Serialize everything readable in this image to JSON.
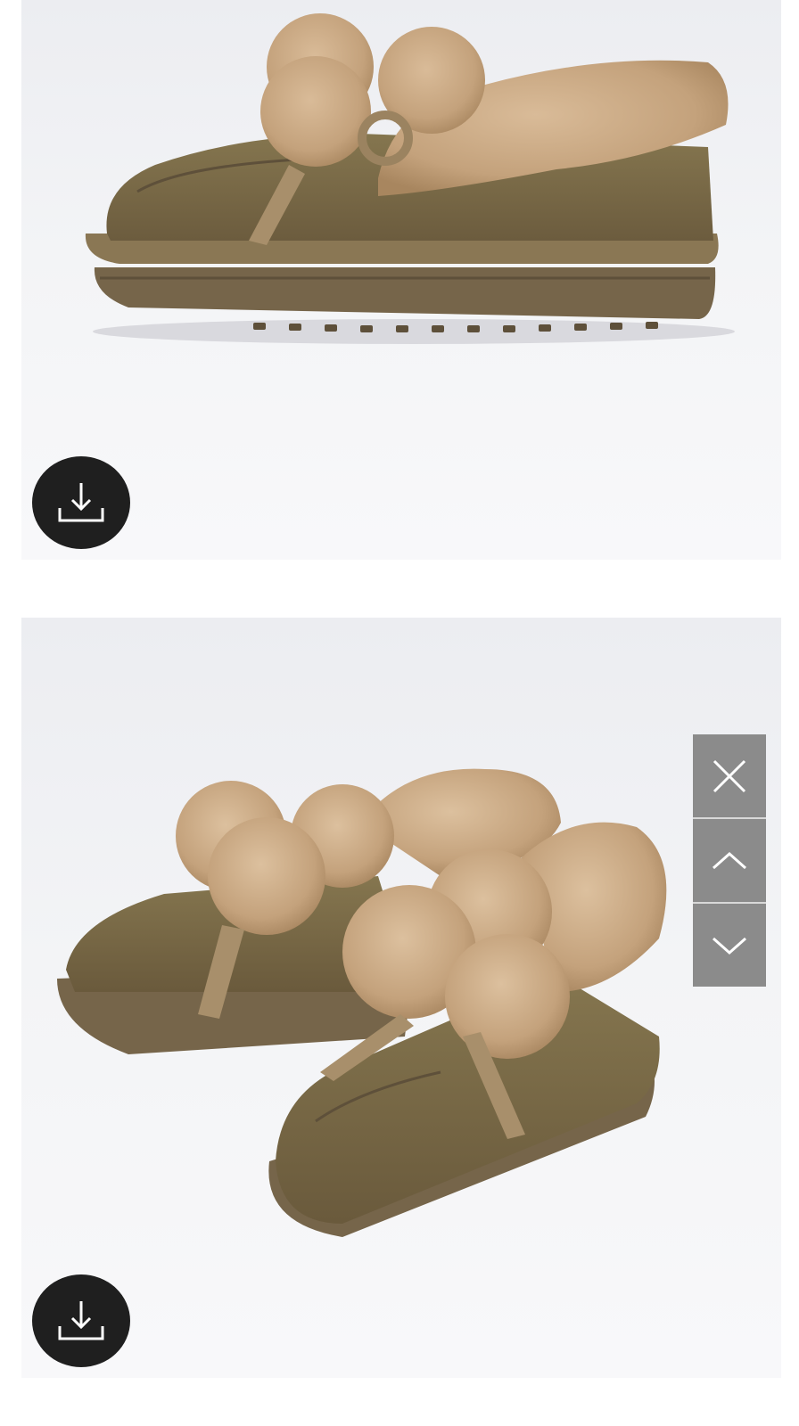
{
  "gallery": {
    "images": [
      {
        "name": "product-photo-side-view"
      },
      {
        "name": "product-photo-pair-view"
      }
    ],
    "download_icon": "download-icon",
    "controls": [
      {
        "name": "close-button",
        "icon": "close-icon"
      },
      {
        "name": "previous-button",
        "icon": "chevron-up-icon"
      },
      {
        "name": "next-button",
        "icon": "chevron-down-icon"
      }
    ]
  },
  "colors": {
    "backdrop": "#eeeff3",
    "suede": "#7a6a49",
    "fur": "#c4a27c",
    "sole": "#7d6c4f",
    "button_dark": "#1f1f1f",
    "control_grey": "#8b8b8b"
  }
}
